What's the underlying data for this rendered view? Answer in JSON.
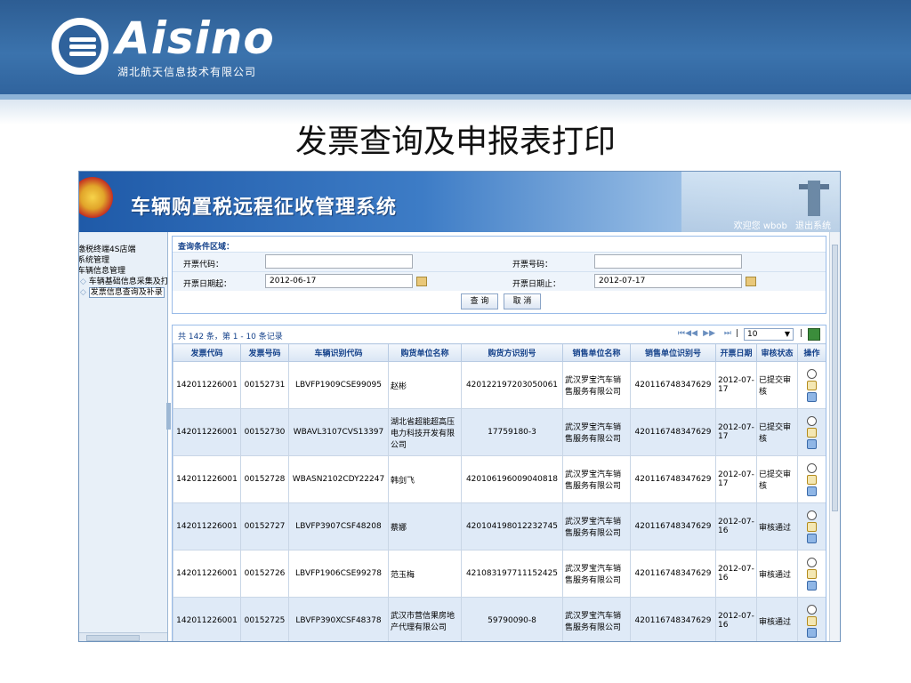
{
  "banner": {
    "brand": "Aisino",
    "company": "湖北航天信息技术有限公司"
  },
  "slide": {
    "title": "发票查询及申报表打印"
  },
  "app": {
    "title": "车辆购置税远程征收管理系统",
    "welcome": "欢迎您 wbob",
    "logout": "退出系统"
  },
  "sidebar": {
    "items": [
      {
        "label": "缴税终端4S店端"
      },
      {
        "label": "系统管理"
      },
      {
        "label": "车辆信息管理"
      },
      {
        "label": "车辆基础信息采集及打"
      },
      {
        "label": "发票信息查询及补录"
      }
    ]
  },
  "query": {
    "caption": "查询条件区域：",
    "invoice_code_label": "开票代码：",
    "invoice_code_value": "",
    "invoice_no_label": "开票号码：",
    "invoice_no_value": "",
    "date_from_label": "开票日期起：",
    "date_from_value": "2012-06-17",
    "date_to_label": "开票日期止：",
    "date_to_value": "2012-07-17",
    "search_button": "查 询",
    "cancel_button": "取 消"
  },
  "grid": {
    "summary": "共 142 条，第 1 - 10 条记录",
    "page_size": "10",
    "columns": [
      "发票代码",
      "发票号码",
      "车辆识别代码",
      "购货单位名称",
      "购货方识别号",
      "销售单位名称",
      "销售单位识别号",
      "开票日期",
      "审核状态",
      "操作"
    ],
    "rows": [
      [
        "142011226001",
        "00152731",
        "LBVFP1909CSE99095",
        "赵彬",
        "420122197203050061",
        "武汉罗宝汽车销售服务有限公司",
        "420116748347629",
        "2012-07-17",
        "已提交审核"
      ],
      [
        "142011226001",
        "00152730",
        "WBAVL3107CVS13397",
        "湖北省超能超高压电力科技开发有限公司",
        "17759180-3",
        "武汉罗宝汽车销售服务有限公司",
        "420116748347629",
        "2012-07-17",
        "已提交审核"
      ],
      [
        "142011226001",
        "00152728",
        "WBASN2102CDY22247",
        "韩剑飞",
        "420106196009040818",
        "武汉罗宝汽车销售服务有限公司",
        "420116748347629",
        "2012-07-17",
        "已提交审核"
      ],
      [
        "142011226001",
        "00152727",
        "LBVFP3907CSF48208",
        "蔡娜",
        "420104198012232745",
        "武汉罗宝汽车销售服务有限公司",
        "420116748347629",
        "2012-07-16",
        "审核通过"
      ],
      [
        "142011226001",
        "00152726",
        "LBVFP1906CSE99278",
        "范玉梅",
        "421083197711152425",
        "武汉罗宝汽车销售服务有限公司",
        "420116748347629",
        "2012-07-16",
        "审核通过"
      ],
      [
        "142011226001",
        "00152725",
        "LBVFP390XCSF48378",
        "武汉市营信果房地产代理有限公司",
        "59790090-8",
        "武汉罗宝汽车销售服务有限公司",
        "420116748347629",
        "2012-07-16",
        "审核通过"
      ]
    ]
  },
  "icons": {
    "view": "magnifier-icon",
    "edit": "edit-icon",
    "print": "printer-icon",
    "export": "excel-icon"
  }
}
